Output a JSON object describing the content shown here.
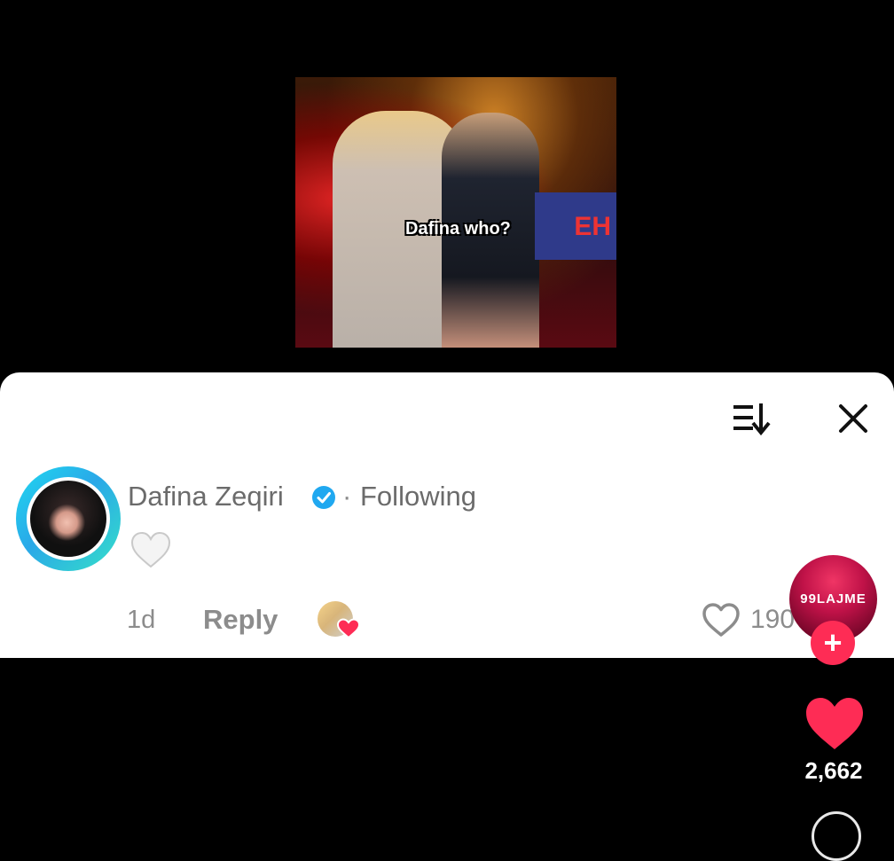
{
  "video": {
    "caption": "Dafina who?",
    "sign_text": "EH"
  },
  "comments_panel": {
    "comment": {
      "username": "Dafina Zeqiri",
      "separator": "·",
      "follow_status": "Following",
      "body_emoji": "white-heart",
      "time": "1d",
      "reply_label": "Reply",
      "like_count": "190"
    }
  },
  "side_bar": {
    "channel_logo": "99LAJME",
    "follow_symbol": "+",
    "like_count": "2,662"
  },
  "icons": {
    "sort": "sort-icon",
    "close": "close-icon",
    "verified": "verified-badge-icon",
    "like": "heart-outline-icon"
  },
  "colors": {
    "accent": "#fe2c55",
    "verified": "#20a8f0",
    "ring": "#1fd8f0"
  }
}
